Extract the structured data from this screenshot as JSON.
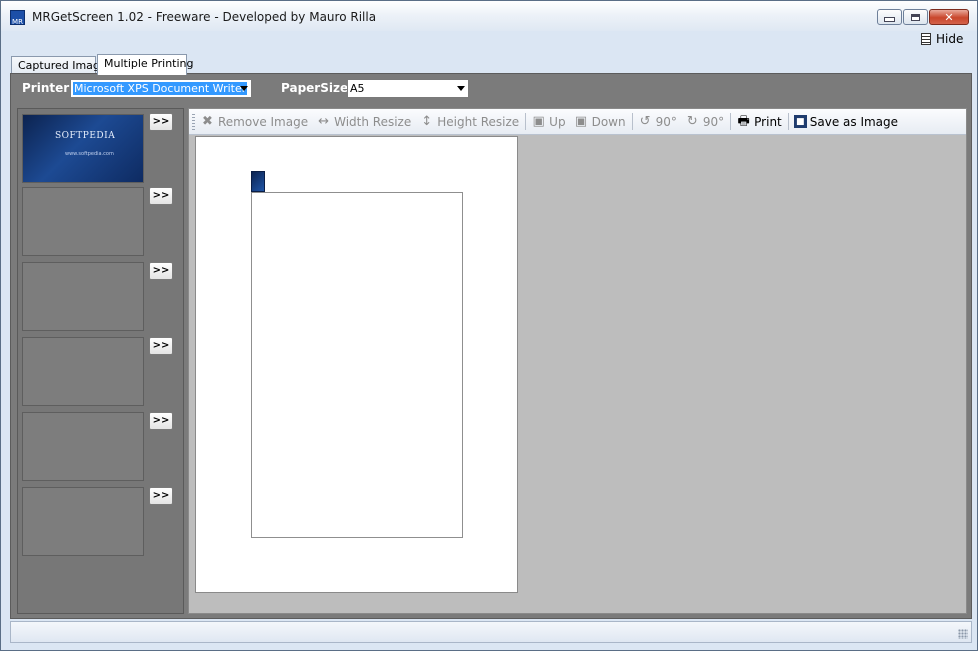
{
  "window": {
    "title": "MRGetScreen 1.02 - Freeware -  Developed by Mauro Rilla",
    "icon_text": "MR",
    "hide_label": "Hide"
  },
  "tabs": [
    {
      "label": "Captured Image",
      "active": false
    },
    {
      "label": "Multiple Printing",
      "active": true
    }
  ],
  "printing": {
    "printer_label": "Printer:",
    "printer_value": "Microsoft XPS Document Writer",
    "papersize_label": "PaperSize:",
    "papersize_value": "A5"
  },
  "thumbnails": {
    "add_label": ">>",
    "slots": [
      {
        "filled": true,
        "logo_text": "SOFTPEDIA",
        "sub_text": "www.softpedia.com"
      },
      {
        "filled": false
      },
      {
        "filled": false
      },
      {
        "filled": false
      },
      {
        "filled": false
      },
      {
        "filled": false
      }
    ]
  },
  "toolbar": {
    "remove_image": "Remove Image",
    "width_resize": "Width Resize",
    "height_resize": "Height Resize",
    "up": "Up",
    "down": "Down",
    "rotate_left": "90°",
    "rotate_right": "90°",
    "print": "Print",
    "save_as_image": "Save as Image"
  },
  "colors": {
    "accent": "#3399ff",
    "panel": "#7b7b7b",
    "workspace": "#bdbdbd"
  }
}
